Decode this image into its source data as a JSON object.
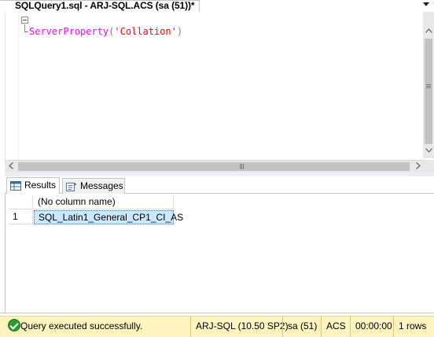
{
  "document_tab": {
    "title": "SQLQuery1.sql - ARJ-SQL.ACS (sa (51))*",
    "dropdown_icon": "chevron-down-icon"
  },
  "editor": {
    "code": {
      "func": "ServerProperty",
      "open_paren": "(",
      "string": "'Collation'",
      "close_paren": ")"
    },
    "colors": {
      "function": "#ff00ff",
      "punctuation": "#808080",
      "string": "#ff0000"
    }
  },
  "scrollbars": {
    "h_grip": "III",
    "left_arrow": "<",
    "right_arrow": ">",
    "v_up_arrow": "^",
    "v_down_arrow": "v"
  },
  "results_tabs": {
    "results_label": "Results",
    "messages_label": "Messages"
  },
  "grid": {
    "columns": [
      "(No column name)"
    ],
    "rows": [
      {
        "row_number": "1",
        "values": [
          "SQL_Latin1_General_CP1_CI_AS"
        ]
      }
    ]
  },
  "status_bar": {
    "message": "Query executed successfully.",
    "server": "ARJ-SQL (10.50 SP2)",
    "user": "sa (51)",
    "database": "ACS",
    "elapsed": "00:00:00",
    "rows": "1 rows",
    "background": "#fdf4bf",
    "success_color": "#2e9b2e"
  }
}
